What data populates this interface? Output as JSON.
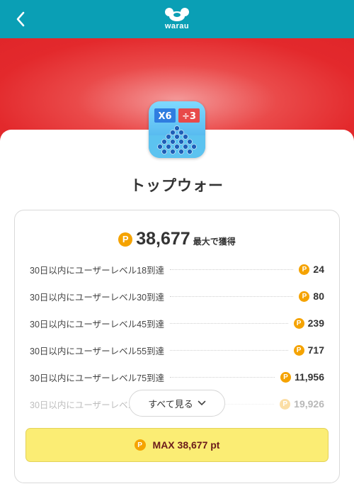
{
  "header": {
    "logo_text": "warau",
    "back_icon": "chevron-left-icon",
    "bg_color": "#0a9fb5"
  },
  "hero": {
    "color": "#e3292c"
  },
  "app": {
    "title": "トップウォー",
    "icon_tag_left": "X6",
    "icon_tag_right": "÷3"
  },
  "reward": {
    "coin_symbol": "P",
    "total": "38,677",
    "total_suffix": "最大で獲得",
    "rows": [
      {
        "label": "30日以内にユーザーレベル18到達",
        "points": "24"
      },
      {
        "label": "30日以内にユーザーレベル30到達",
        "points": "80"
      },
      {
        "label": "30日以内にユーザーレベル45到達",
        "points": "239"
      },
      {
        "label": "30日以内にユーザーレベル55到達",
        "points": "717"
      },
      {
        "label": "30日以内にユーザーレベル75到達",
        "points": "11,956"
      },
      {
        "label": "30日以内にユーザーレベル",
        "points": "19,926"
      }
    ],
    "see_all_label": "すべて見る",
    "max_button_label": "MAX 38,677 pt"
  },
  "colors": {
    "coin": "#f5a300",
    "max_button": "#fbed74",
    "max_text": "#6b1a1a"
  }
}
